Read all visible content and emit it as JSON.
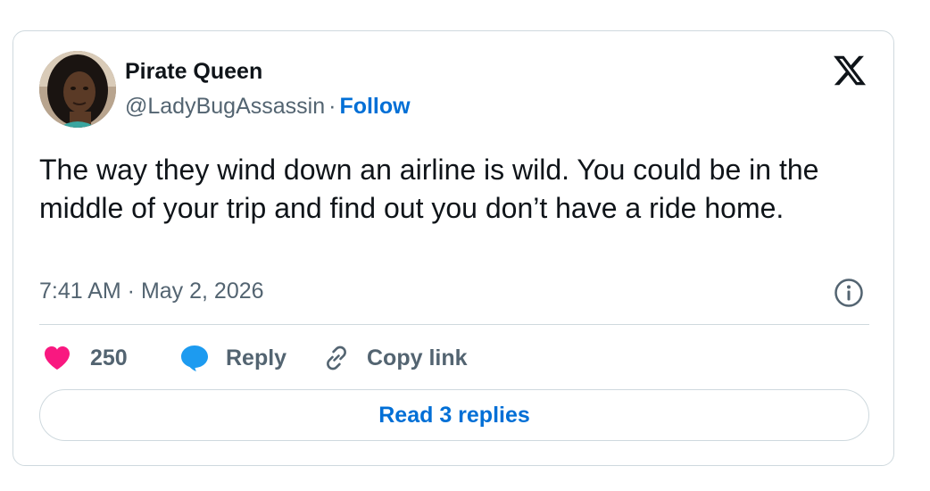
{
  "author": {
    "name": "Pirate Queen",
    "handle": "@LadyBugAssassin",
    "separator": "·",
    "follow_label": "Follow"
  },
  "tweet": {
    "text": "The way they wind down an airline is wild. You could be in the middle of your trip and find out you don’t have a ride home.",
    "timestamp": "7:41 AM · May 2, 2026"
  },
  "actions": {
    "like_count": "250",
    "reply_label": "Reply",
    "copy_link_label": "Copy link",
    "read_replies_label": "Read 3 replies"
  },
  "icons": {
    "logo": "x-logo-icon",
    "info": "info-icon",
    "like": "heart-icon",
    "reply": "speech-bubble-icon",
    "copy": "link-icon"
  },
  "colors": {
    "heart": "#f91880",
    "reply_bubble": "#1d9bf0",
    "link_blue": "#006fd6",
    "text_primary": "#0f1419",
    "text_secondary": "#536471",
    "border": "#cfd9de"
  }
}
